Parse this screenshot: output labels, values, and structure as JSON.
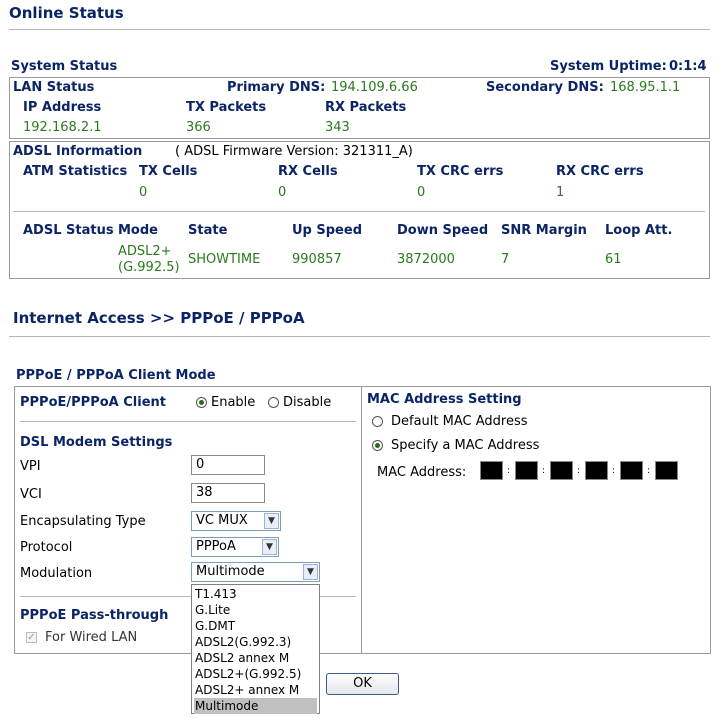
{
  "page": {
    "title": "Online Status",
    "section2_title": "Internet Access >> PPPoE / PPPoA"
  },
  "system_status": {
    "label": "System Status",
    "uptime_label": "System Uptime:",
    "uptime_value": "0:1:4"
  },
  "lan": {
    "label": "LAN Status",
    "primary_dns_label": "Primary DNS:",
    "primary_dns": "194.109.6.66",
    "secondary_dns_label": "Secondary DNS:",
    "secondary_dns": "168.95.1.1",
    "headers": [
      "IP Address",
      "TX Packets",
      "RX Packets"
    ],
    "values": [
      "192.168.2.1",
      "366",
      "343"
    ]
  },
  "adsl": {
    "label": "ADSL Information",
    "firmware": "( ADSL Firmware Version:  321311_A)",
    "atm_label": "ATM Statistics",
    "atm_headers": [
      "TX Cells",
      "RX Cells",
      "TX CRC errs",
      "RX CRC errs"
    ],
    "atm_values": [
      "0",
      "0",
      "0",
      "1"
    ],
    "status_label": "ADSL Status",
    "status_headers": [
      "Mode",
      "State",
      "Up Speed",
      "Down Speed",
      "SNR Margin",
      "Loop Att."
    ],
    "mode_line1": "ADSL2+",
    "mode_line2": "(G.992.5)",
    "state": "SHOWTIME",
    "up_speed": "990857",
    "down_speed": "3872000",
    "snr_margin": "7",
    "loop_att": "61"
  },
  "client_mode": {
    "title": "PPPoE / PPPoA Client Mode",
    "client_label": "PPPoE/PPPoA Client",
    "enable_label": "Enable",
    "disable_label": "Disable",
    "selected": "Enable",
    "dsl_settings_label": "DSL Modem Settings",
    "vpi_label": "VPI",
    "vpi_value": "0",
    "vci_label": "VCI",
    "vci_value": "38",
    "encap_label": "Encapsulating Type",
    "encap_value": "VC MUX",
    "protocol_label": "Protocol",
    "protocol_value": "PPPoA",
    "modulation_label": "Modulation",
    "modulation_value": "Multimode",
    "modulation_options": [
      "T1.413",
      "G.Lite",
      "G.DMT",
      "ADSL2(G.992.3)",
      "ADSL2 annex M",
      "ADSL2+(G.992.5)",
      "ADSL2+ annex M",
      "Multimode"
    ],
    "passthrough_label": "PPPoE Pass-through",
    "wired_lan_label": "For Wired LAN"
  },
  "mac": {
    "title": "MAC Address Setting",
    "default_label": "Default MAC Address",
    "specify_label": "Specify a MAC Address",
    "selected": "Specify a MAC Address",
    "address_label": "MAC Address:"
  },
  "ok_button": "OK"
}
